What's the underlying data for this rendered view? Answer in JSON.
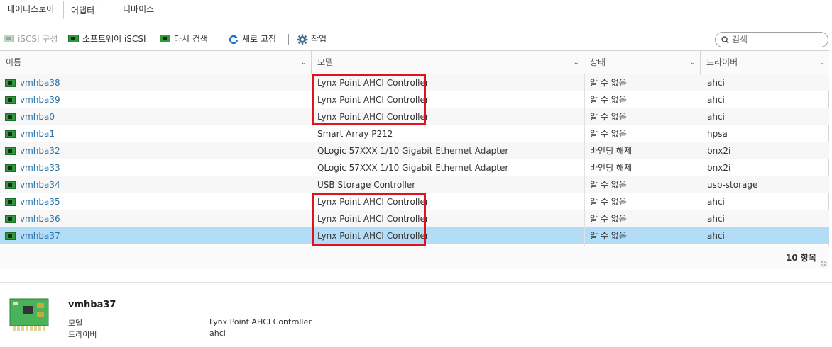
{
  "tabs": [
    {
      "label": "데이터스토어",
      "active": false
    },
    {
      "label": "어댑터",
      "active": true
    },
    {
      "label": "디바이스",
      "active": false
    }
  ],
  "toolbar": {
    "iscsi_config": "iSCSI 구성",
    "software_iscsi": "소프트웨어 iSCSI",
    "rescan": "다시 검색",
    "refresh": "새로 고침",
    "actions": "작업"
  },
  "search": {
    "placeholder": "검색",
    "value": ""
  },
  "columns": [
    "이름",
    "모델",
    "상태",
    "드라이버"
  ],
  "rows": [
    {
      "name": "vmhba38",
      "model": "Lynx Point AHCI Controller",
      "status": "알 수 없음",
      "driver": "ahci"
    },
    {
      "name": "vmhba39",
      "model": "Lynx Point AHCI Controller",
      "status": "알 수 없음",
      "driver": "ahci"
    },
    {
      "name": "vmhba0",
      "model": "Lynx Point AHCI Controller",
      "status": "알 수 없음",
      "driver": "ahci"
    },
    {
      "name": "vmhba1",
      "model": "Smart Array P212",
      "status": "알 수 없음",
      "driver": "hpsa"
    },
    {
      "name": "vmhba32",
      "model": "QLogic 57XXX 1/10 Gigabit Ethernet Adapter",
      "status": "바인딩 해제",
      "driver": "bnx2i"
    },
    {
      "name": "vmhba33",
      "model": "QLogic 57XXX 1/10 Gigabit Ethernet Adapter",
      "status": "바인딩 해제",
      "driver": "bnx2i"
    },
    {
      "name": "vmhba34",
      "model": "USB Storage Controller",
      "status": "알 수 없음",
      "driver": "usb-storage"
    },
    {
      "name": "vmhba35",
      "model": "Lynx Point AHCI Controller",
      "status": "알 수 없음",
      "driver": "ahci"
    },
    {
      "name": "vmhba36",
      "model": "Lynx Point AHCI Controller",
      "status": "알 수 없음",
      "driver": "ahci"
    },
    {
      "name": "vmhba37",
      "model": "Lynx Point AHCI Controller",
      "status": "알 수 없음",
      "driver": "ahci"
    }
  ],
  "item_count": "10 항목",
  "detail": {
    "title": "vmhba37",
    "model_label": "모델",
    "model_value": "Lynx Point AHCI Controller",
    "driver_label": "드라이버",
    "driver_value": "ahci"
  },
  "colors": {
    "selected_row": "#b3dcf7",
    "highlight": "#e0121e",
    "link": "#2a73a8"
  }
}
